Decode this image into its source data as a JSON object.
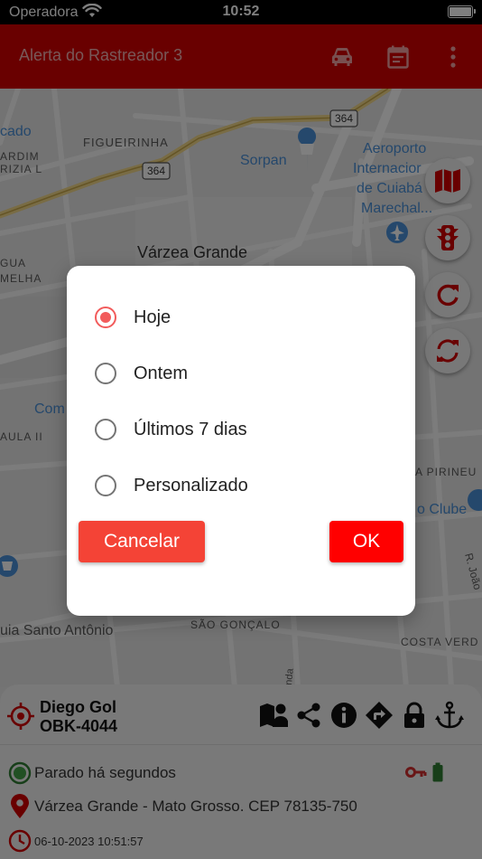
{
  "status_bar": {
    "carrier": "Operadora",
    "time": "10:52"
  },
  "app_bar": {
    "title": "Alerta do Rastreador 3",
    "icons": [
      "car-icon",
      "calendar-icon",
      "more-vert-icon"
    ]
  },
  "map": {
    "labels": {
      "cado": "cado",
      "figueirinha": "FIGUEIRINHA",
      "ardim": "ARDIM",
      "rizia": "RIZIA L",
      "sorpan": "Sorpan",
      "aeroporto1": "Aeroporto",
      "aeroporto2": "Internacior",
      "aeroporto3": "de Cuiabá",
      "aeroporto4": "Marechal...",
      "varzea": "Várzea Grande",
      "gua": "GUA",
      "melha": "MELHA",
      "com": "Com",
      "aula": "AULA II",
      "pirineu": "A PIRINEU",
      "clube": "o Clube",
      "joao": "R. João",
      "santo_antonio": "uia Santo Antônio",
      "sao_goncalo": "SÃO GONÇALO",
      "costa_verde": "COSTA VERD",
      "nda": "nda",
      "road_a": "364",
      "road_b": "364"
    }
  },
  "fabs": [
    "map-icon",
    "traffic-light-icon",
    "refresh-icon",
    "sync-icon"
  ],
  "vehicle": {
    "driver": "Diego Gol",
    "plate": "OBK-4044",
    "status": "Parado há segundos",
    "address": "Várzea Grande - Mato Grosso. CEP 78135-750",
    "timestamp": "06-10-2023 10:51:57",
    "action_icons": [
      "map-person-icon",
      "share-icon",
      "info-icon",
      "directions-icon",
      "lock-icon",
      "anchor-icon"
    ]
  },
  "dialog": {
    "options": [
      {
        "label": "Hoje",
        "selected": true
      },
      {
        "label": "Ontem",
        "selected": false
      },
      {
        "label": "Últimos 7 dias",
        "selected": false
      },
      {
        "label": "Personalizado",
        "selected": false
      }
    ],
    "cancel_label": "Cancelar",
    "ok_label": "OK"
  },
  "colors": {
    "brand_red": "#d30000",
    "accent": "#f25c5c",
    "ok_button": "#ff0000",
    "cancel_button": "#f44336"
  }
}
